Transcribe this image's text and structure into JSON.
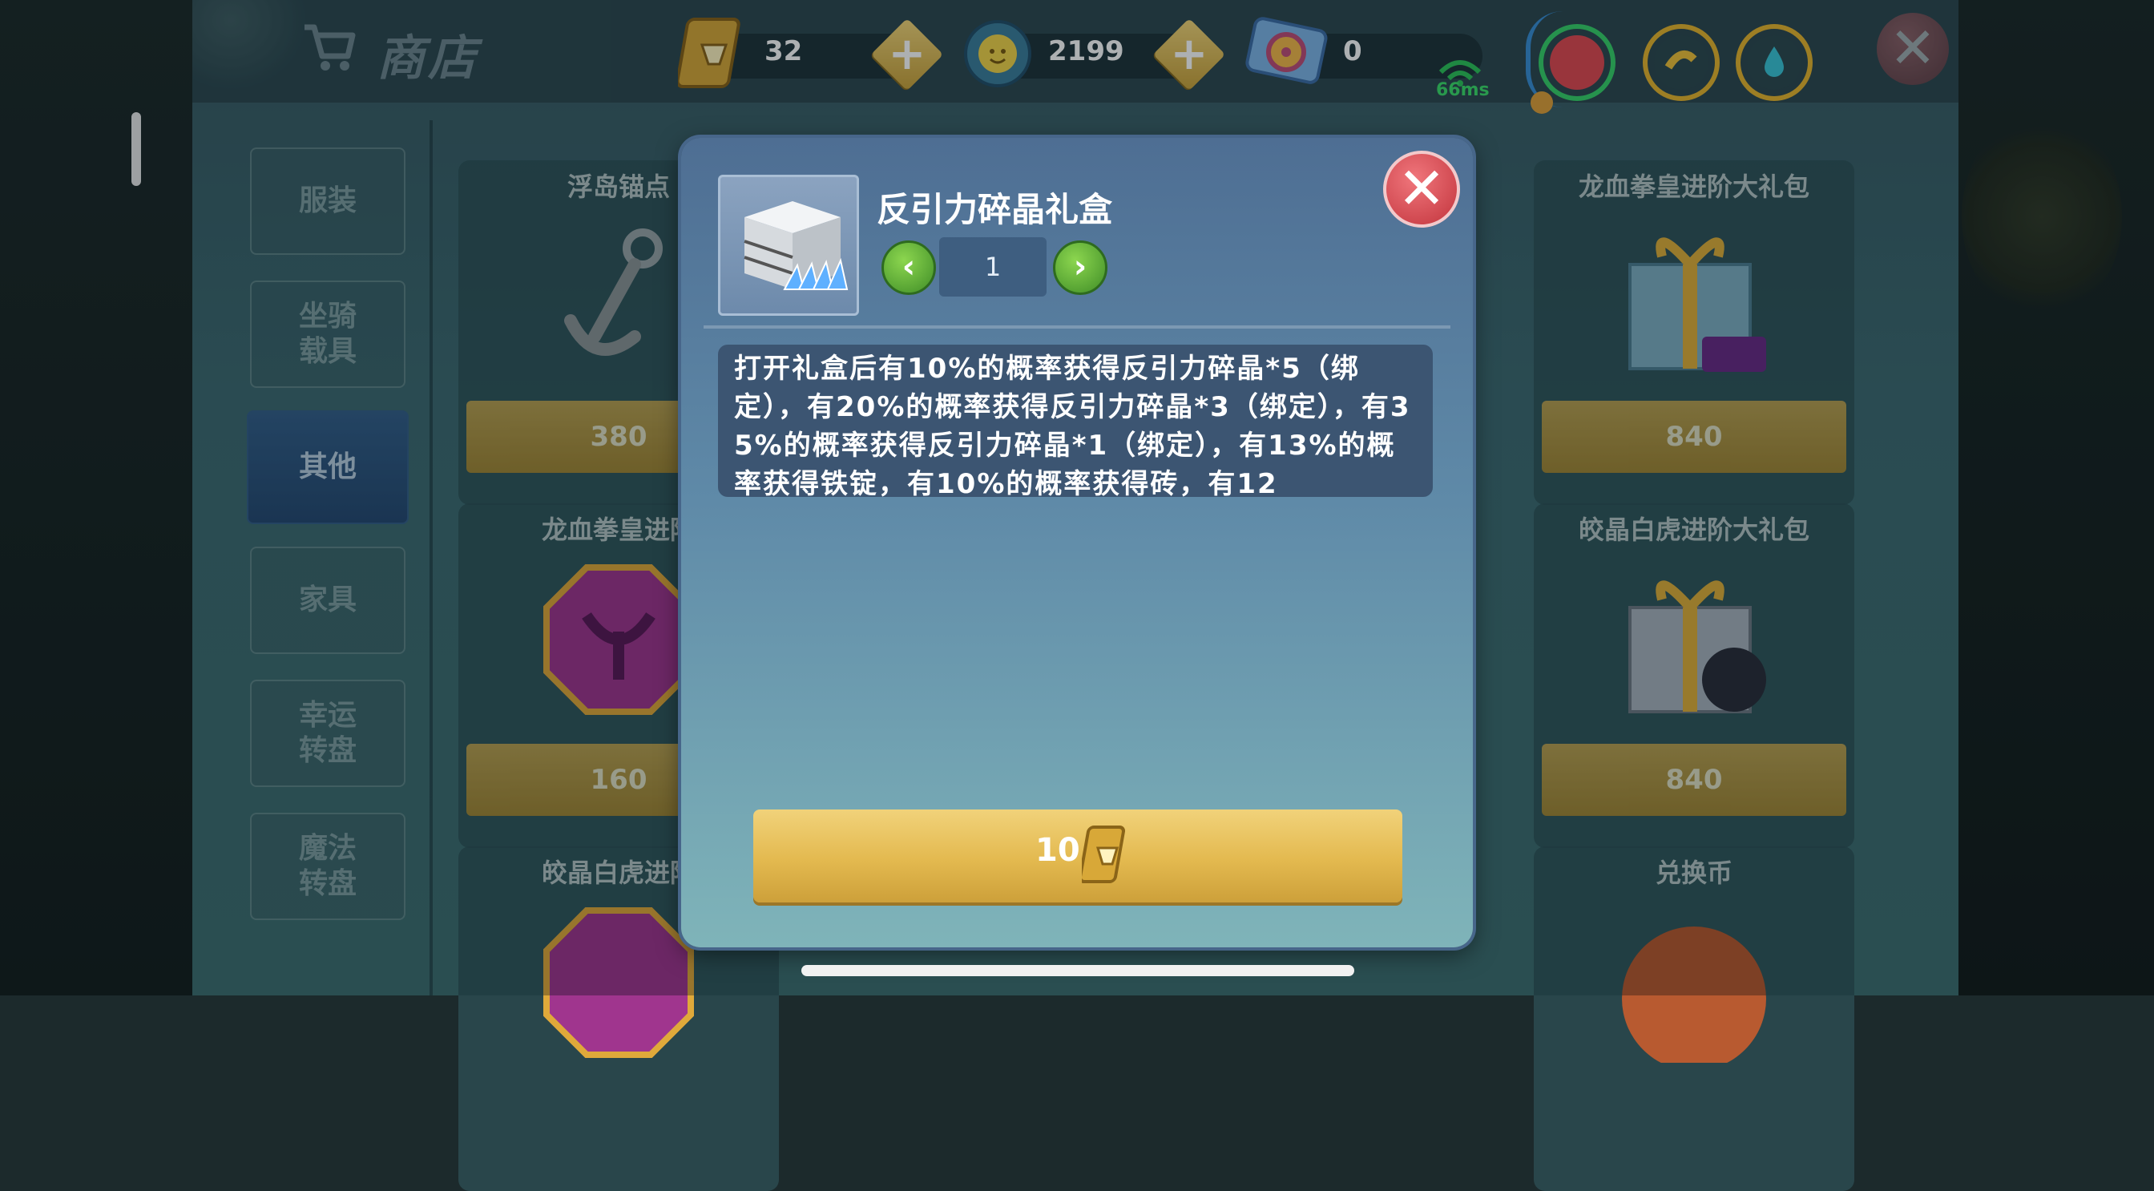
{
  "header": {
    "title": "商店",
    "gems": "32",
    "coins": "2199",
    "tickets": "0",
    "ping": "66ms"
  },
  "sidebar": {
    "tabs": [
      {
        "label": "服装"
      },
      {
        "label": "坐骑\n载具"
      },
      {
        "label": "其他"
      },
      {
        "label": "家具"
      },
      {
        "label": "幸运\n转盘"
      },
      {
        "label": "魔法\n转盘"
      }
    ]
  },
  "cards": [
    {
      "title": "浮岛锚点",
      "price": "380"
    },
    {
      "title": "龙血拳皇进阶",
      "price": "160"
    },
    {
      "title": "皎晶白虎进阶",
      "price": ""
    },
    {
      "title": "龙血拳皇进阶大礼包",
      "price": "840"
    },
    {
      "title": "皎晶白虎进阶大礼包",
      "price": "840"
    },
    {
      "title": "兑换币",
      "price": ""
    }
  ],
  "modal": {
    "item_name": "反引力碎晶礼盒",
    "quantity": "1",
    "description": "打开礼盒后有10%的概率获得反引力碎晶*5（绑定），有20%的概率获得反引力碎晶*3（绑定），有35%的概率获得反引力碎晶*1（绑定），有13%的概率获得铁锭，有10%的概率获得砖，有12",
    "buy_price": "10"
  },
  "colors": {
    "buy_button": "#e3b94f",
    "close_button": "#d9484f",
    "arrow_button": "#5aa832",
    "active_tab": "#2f5680"
  }
}
